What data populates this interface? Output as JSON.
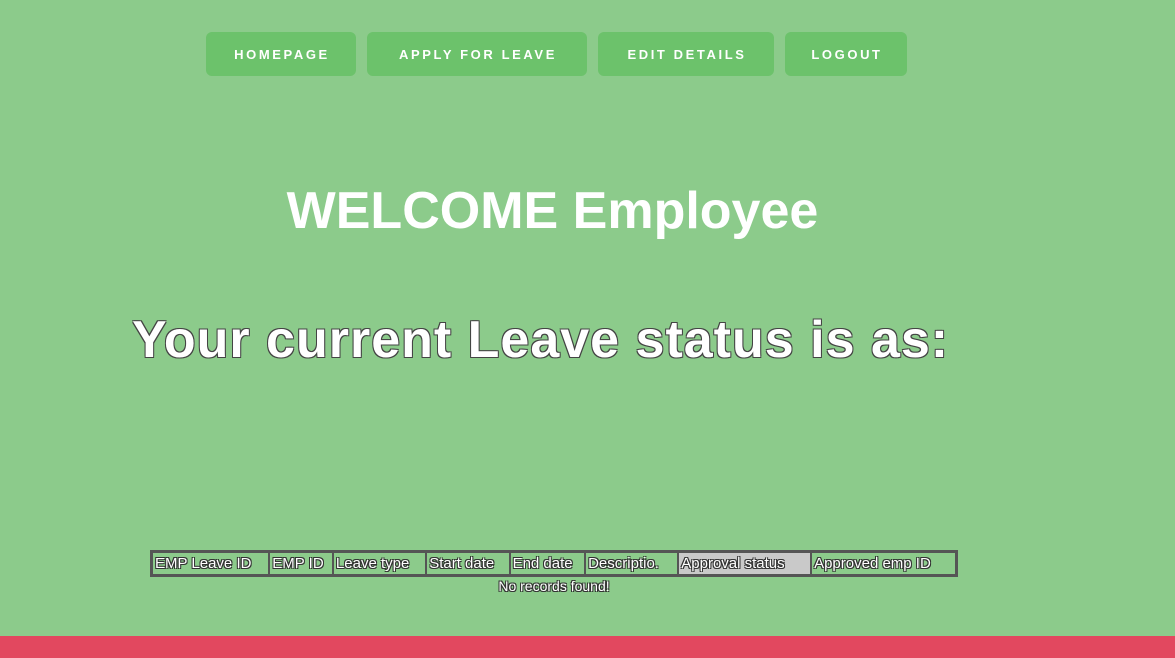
{
  "nav": {
    "homepage": "HOMEPAGE",
    "apply_leave": "APPLY FOR LEAVE",
    "edit_details": "EDIT DETAILS",
    "logout": "LOGOUT"
  },
  "welcome_title": "WELCOME Employee",
  "status_heading": "Your current Leave status is as:",
  "table": {
    "headers": [
      "EMP Leave ID",
      "EMP ID",
      "Leave type",
      "Start date",
      "End date",
      "Descriptio.",
      "Approval status",
      "Approved emp ID"
    ],
    "empty_message": "No records found!"
  },
  "colors": {
    "background": "#8ccb8b",
    "nav_button": "#6cc26b",
    "footer": "#e2485f",
    "text": "#ffffff"
  }
}
